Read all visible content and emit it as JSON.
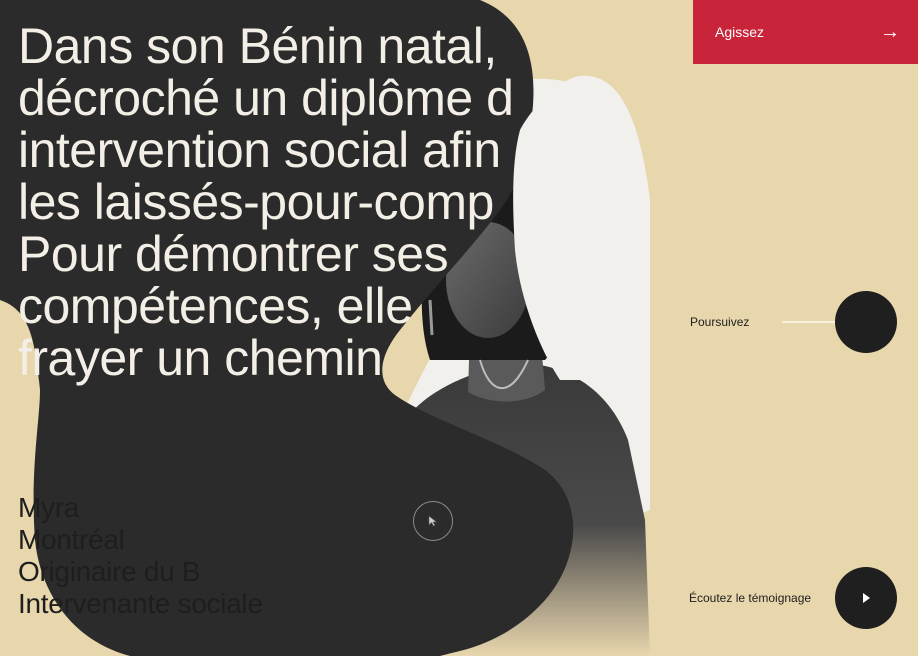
{
  "headline": {
    "lines": [
      "Dans son Bénin natal,",
      "décroché un diplôme d",
      "intervention social afin",
      "les laissés-pour-comp",
      "Pour démontrer ses",
      "compétences, elle",
      "frayer un chemin"
    ]
  },
  "bio": {
    "lines": [
      "Myra",
      "Montréal",
      "Originaire du B",
      "Intervenante sociale"
    ]
  },
  "cta": {
    "label": "Agissez",
    "icon": "arrow-right-icon"
  },
  "continue": {
    "label": "Poursuivez",
    "icon": "arrow-right-icon"
  },
  "testimony": {
    "label": "Écoutez le témoignage",
    "icon": "play-icon"
  },
  "colors": {
    "background": "#e8d6ad",
    "blob": "#2b2b2b",
    "accent": "#c8243a",
    "white_shape": "#f1f0ed",
    "headline_text": "#f3efe6"
  }
}
